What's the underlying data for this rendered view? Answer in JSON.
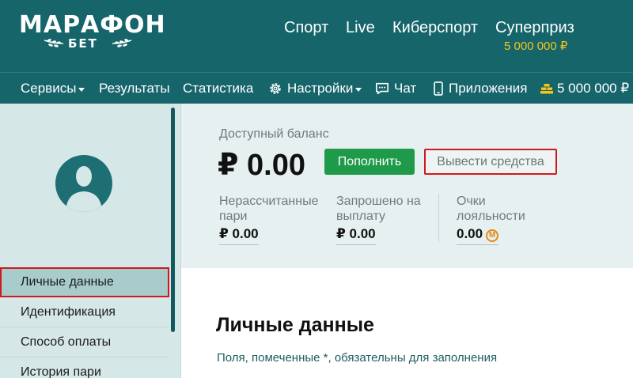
{
  "brand": {
    "name": "МАРАФОН",
    "sub": "БЕТ"
  },
  "topnav": {
    "sport": "Спорт",
    "live": "Live",
    "esports": "Киберспорт",
    "superprize": "Суперприз",
    "superprize_amount": "5 000 000 ₽"
  },
  "secnav": {
    "services": "Сервисы",
    "results": "Результаты",
    "statistics": "Статистика",
    "settings": "Настройки",
    "chat": "Чат",
    "apps": "Приложения",
    "jackpot": "5 000 000 ₽"
  },
  "sidebar": {
    "items": [
      {
        "label": "Личные данные"
      },
      {
        "label": "Идентификация"
      },
      {
        "label": "Способ оплаты"
      },
      {
        "label": "История пари"
      }
    ]
  },
  "balance": {
    "label": "Доступный баланс",
    "value": "₽ 0.00",
    "topup_label": "Пополнить",
    "withdraw_label": "Вывести средства",
    "unsettled_label_1": "Нерассчитанные",
    "unsettled_label_2": "пари",
    "unsettled_value": "₽ 0.00",
    "requested_label_1": "Запрошено на",
    "requested_label_2": "выплату",
    "requested_value": "₽ 0.00",
    "loyalty_label_1": "Очки",
    "loyalty_label_2": "лояльности",
    "loyalty_value": "0.00",
    "coin_symbol": "М"
  },
  "content": {
    "title": "Личные данные",
    "note": "Поля, помеченные *, обязательны для заполнения"
  },
  "colors": {
    "header": "#16656b",
    "prize": "#f5c518",
    "topup": "#1f9a4a",
    "highlight": "#d0191f"
  }
}
